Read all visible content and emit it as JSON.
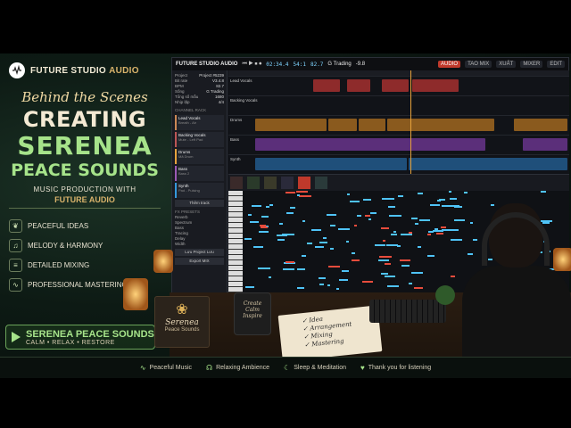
{
  "brand": {
    "name_a": "FUTURE STUDIO",
    "name_b": "AUDIO"
  },
  "hero": {
    "script": "Behind the Scenes",
    "line1": "CREATING",
    "line2": "SERENEA",
    "line3": "PEACE SOUNDS",
    "sub1": "MUSIC PRODUCTION WITH",
    "sub2": "FUTURE AUDIO"
  },
  "features": [
    {
      "icon": "leaf-icon",
      "glyph": "❦",
      "label": "PEACEFUL IDEAS"
    },
    {
      "icon": "music-note-icon",
      "glyph": "♫",
      "label": "MELODY & HARMONY"
    },
    {
      "icon": "sliders-icon",
      "glyph": "≡",
      "label": "DETAILED MIXING"
    },
    {
      "icon": "waveform-icon",
      "glyph": "∿",
      "label": "PROFESSIONAL MASTERING"
    }
  ],
  "cta": {
    "title": "SERENEA PEACE SOUNDS",
    "tagline": "CALM • RELAX • RESTORE"
  },
  "daw": {
    "title": "FUTURE STUDIO AUDIO",
    "time": "02:34.4",
    "bars": "54:1",
    "tempo": "82.7",
    "tool": "G Trading",
    "db": "-9.8",
    "buttons": [
      "AUDIO",
      "TAO MIX",
      "XUẤT",
      "MIXER",
      "EDIT"
    ],
    "project": [
      {
        "k": "Project",
        "v": "Project #5239"
      },
      {
        "k": "Bit rate",
        "v": "V3.4.8"
      },
      {
        "k": "BPM",
        "v": "82.7"
      },
      {
        "k": "Sống",
        "v": "G Trading"
      },
      {
        "k": "Tổng số mẫu",
        "v": "1680"
      },
      {
        "k": "Nhịp lặp",
        "v": "4/4"
      }
    ],
    "sidebar_header": "CHANNEL RACK",
    "tracks": [
      {
        "name": "Lead Vocals",
        "sub": "Breath - Air"
      },
      {
        "name": "Backing Vocals",
        "sub": "Mute - Left Pad"
      },
      {
        "name": "Drums",
        "sub": "Mã Drum"
      },
      {
        "name": "Bass",
        "sub": "Bass 2"
      },
      {
        "name": "Synth",
        "sub": "Pad - Pulsing"
      }
    ],
    "add_track": "Thêm track",
    "fx_header": "FX PRESETS",
    "fx": [
      "Reverb",
      "Spectrum",
      "Bass",
      "Tracing",
      "Delay",
      "Width"
    ],
    "save_label": "Lưu Project Lưu",
    "export_label": "Export MIX",
    "lanes": [
      "Lead Vocals",
      "Backing Vocals",
      "Drums",
      "Bass",
      "Synth"
    ]
  },
  "desk": {
    "serena_name": "Serenea",
    "serena_sub": "Peace Sounds",
    "mug": [
      "Create",
      "Calm",
      "Inspire"
    ],
    "notebook": [
      "✓ Idea",
      "✓ Arrangement",
      "✓ Mixing",
      "✓ Mastering"
    ]
  },
  "bottom": [
    {
      "icon": "waveform-icon",
      "glyph": "∿",
      "label": "Peaceful Music"
    },
    {
      "icon": "headphones-icon",
      "glyph": "☊",
      "label": "Relaxing Ambience"
    },
    {
      "icon": "moon-icon",
      "glyph": "☾",
      "label": "Sleep & Meditation"
    },
    {
      "icon": "heart-icon",
      "glyph": "♥",
      "label": "Thank you for listening"
    }
  ]
}
